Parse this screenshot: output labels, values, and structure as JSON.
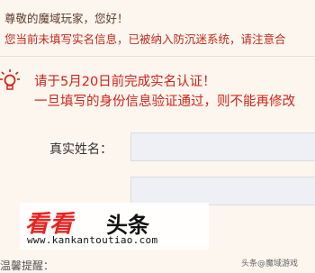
{
  "header": {
    "greeting": "尊敬的魔域玩家，您好！",
    "notice": "您当前未填写实名信息，已被纳入防沉迷系统，请注意合"
  },
  "warning": {
    "icon": "lightbulb-icon",
    "color": "#d02419",
    "line1": "请于5月20日前完成实名认证！",
    "line2": "一旦填写的身份信息验证通过，则不能再修改"
  },
  "form": {
    "name_label": "真实姓名：",
    "name_value": ""
  },
  "watermark": {
    "brand": "看看",
    "headline": "头条",
    "url": "www.kankantoutiao.com"
  },
  "footer": {
    "hint": "温馨提醒：",
    "credit": "头条@魔域游戏"
  }
}
